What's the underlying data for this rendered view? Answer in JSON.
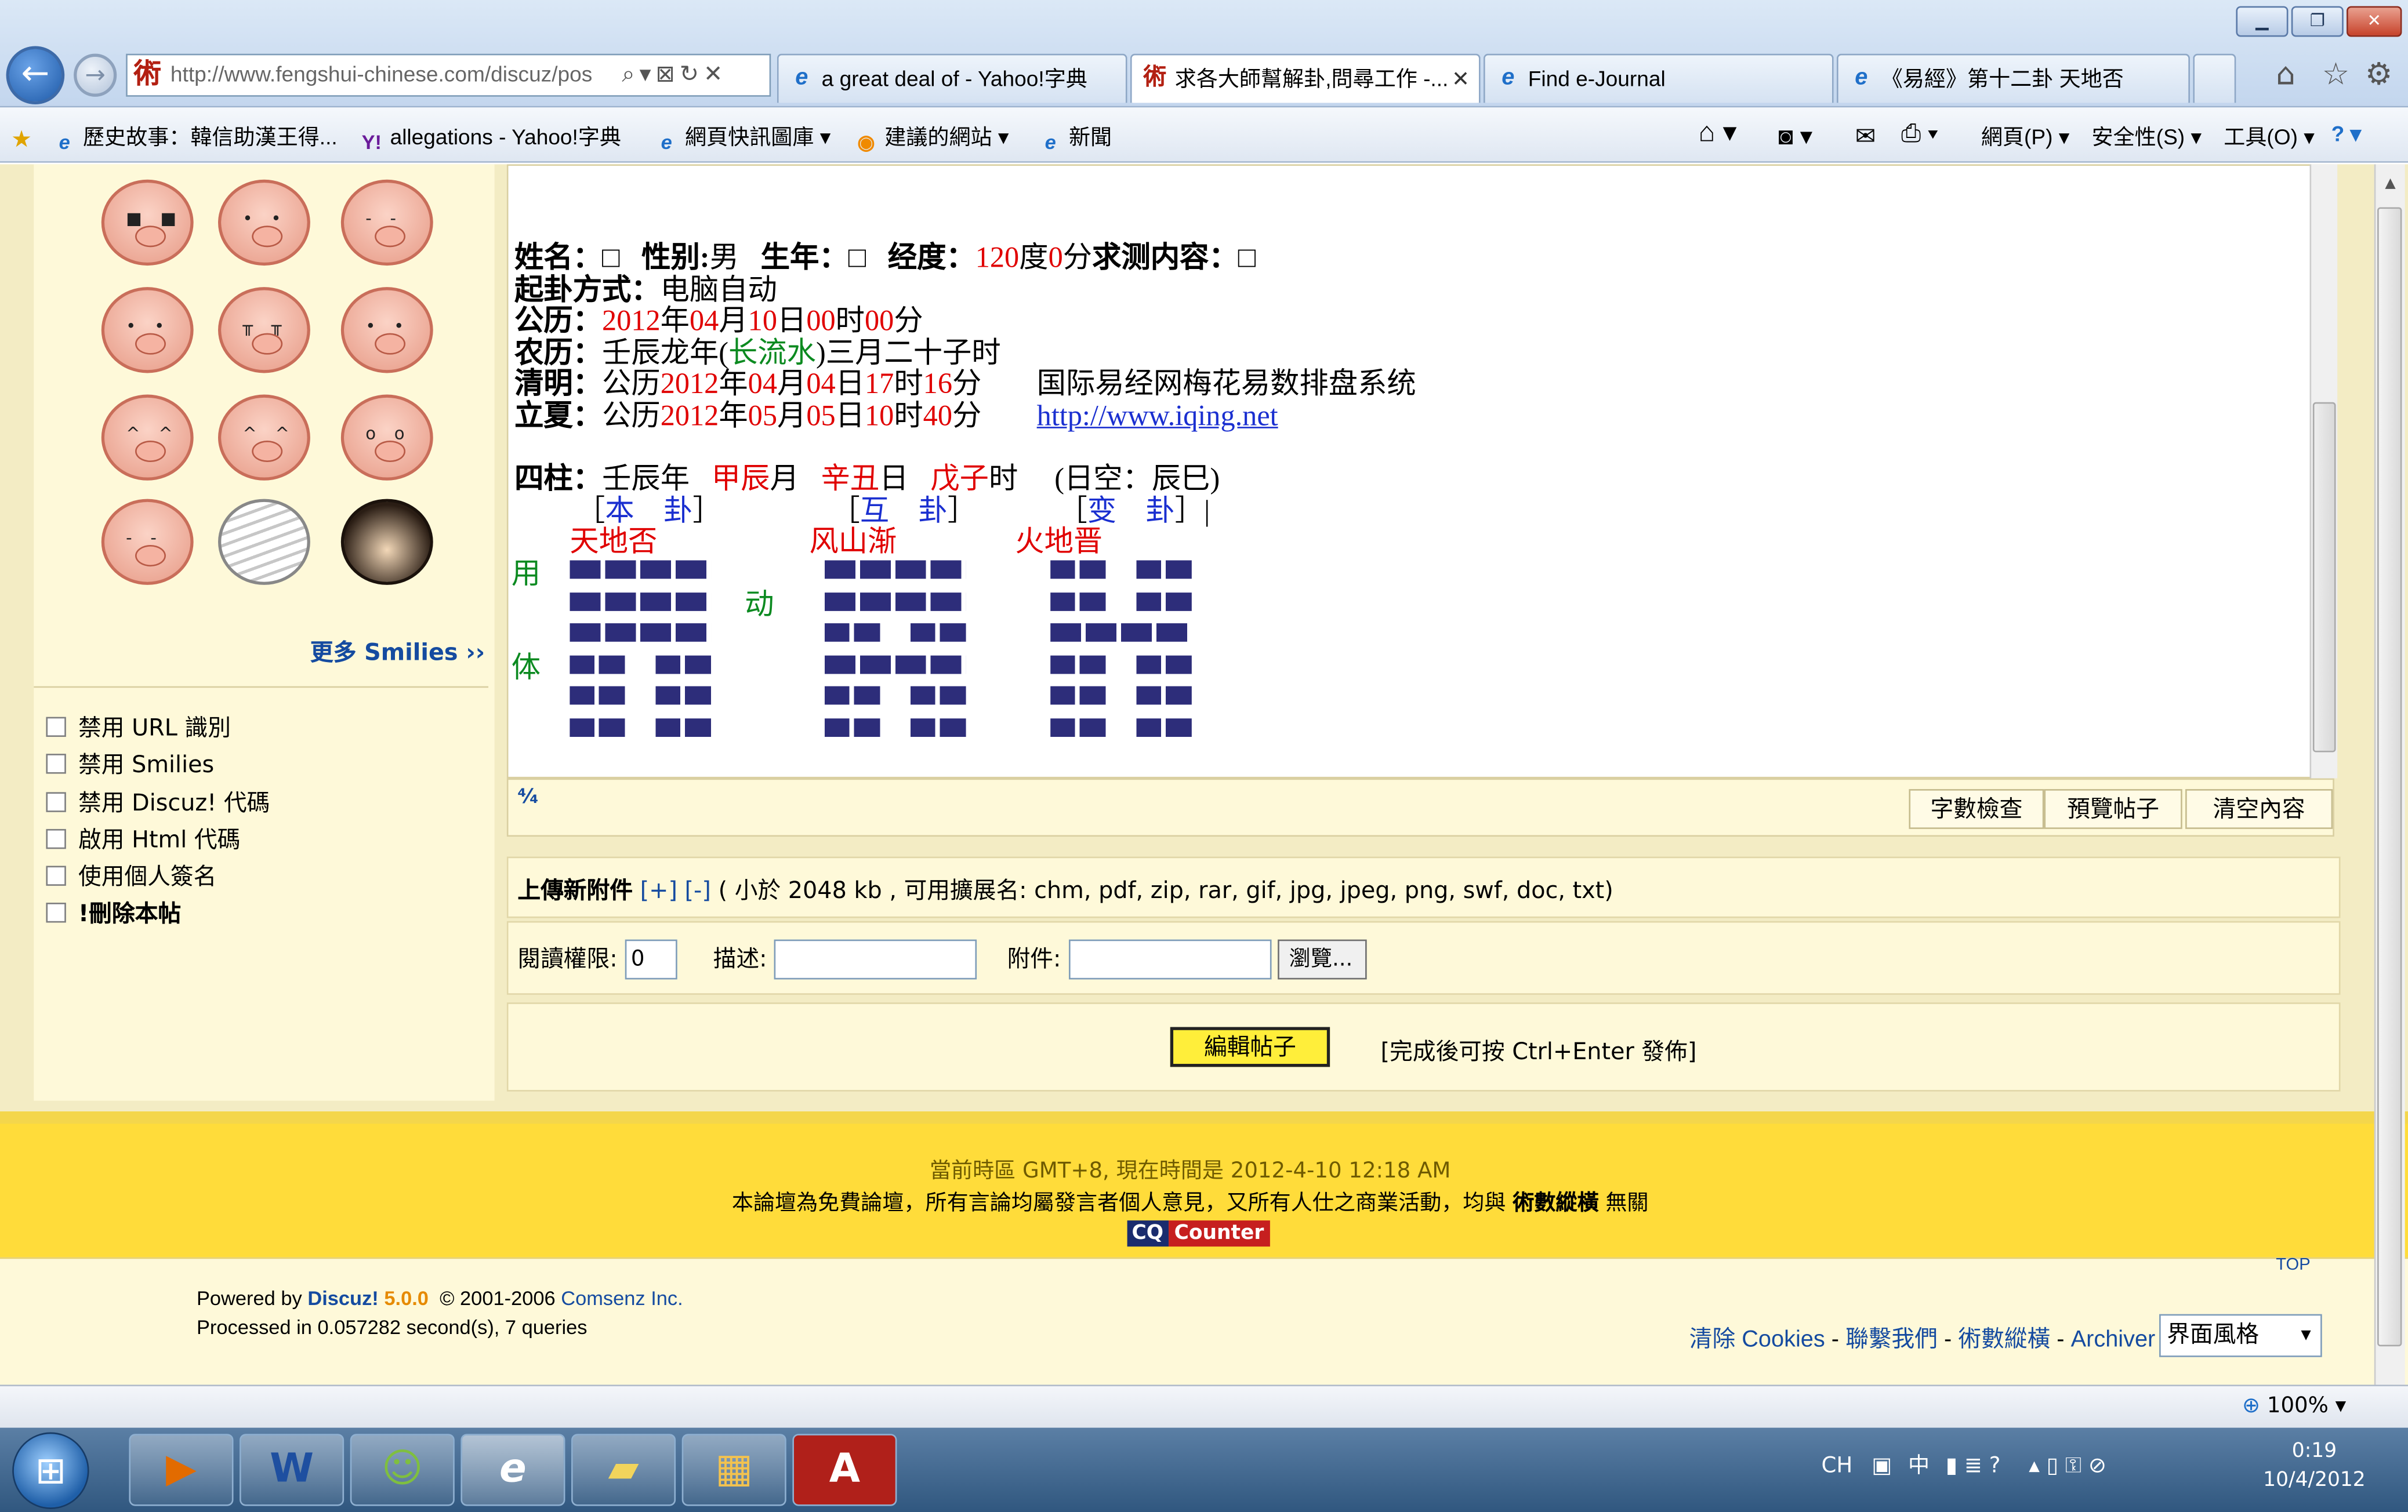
{
  "browser": {
    "address_url": "http://www.fengshui-chinese.com/discuz/pos",
    "tabs": [
      {
        "title": "a great deal of - Yahoo!字典"
      },
      {
        "title": "求各大師幫解卦,問尋工作 -..."
      },
      {
        "title": "Find e-Journal"
      },
      {
        "title": "《易經》第十二卦  天地否"
      }
    ],
    "favorites": [
      {
        "label": "歷史故事：韓信助漢王得..."
      },
      {
        "label": "allegations - Yahoo!字典"
      },
      {
        "label": "網頁快訊圖庫"
      },
      {
        "label": "建議的網站"
      },
      {
        "label": "新聞"
      }
    ],
    "menus": {
      "page": "網頁(P)",
      "safety": "安全性(S)",
      "tools": "工具(O)"
    }
  },
  "sidebar": {
    "more_smilies": "更多 Smilies ››",
    "options": [
      {
        "label": "禁用 URL 識別"
      },
      {
        "label": "禁用 Smilies"
      },
      {
        "label": "禁用 Discuz! 代碼"
      },
      {
        "label": "啟用 Html 代碼"
      },
      {
        "label": "使用個人簽名"
      },
      {
        "label": "!刪除本帖"
      }
    ]
  },
  "post": {
    "header_line": {
      "name_label": "姓名：",
      "gender_label": "性别:",
      "gender": "男",
      "birth_label": "生年：",
      "longitude_label": "经度：",
      "longitude_value": "120",
      "deg_unit": "度",
      "min_value": "0",
      "min_unit": "分",
      "query_label": "求测内容："
    },
    "method_label": "起卦方式：",
    "method": "电脑自动",
    "solar_label": "公历：",
    "solar": {
      "y": "2012",
      "m": "04",
      "d": "10",
      "h": "00",
      "mi": "00"
    },
    "units": {
      "y": "年",
      "m": "月",
      "d": "日",
      "h": "时",
      "mi": "分"
    },
    "lunar_label": "农历：",
    "lunar_a": "壬辰龙年(",
    "lunar_b": "长流水",
    "lunar_c": ")三月二十子时",
    "qingming_label": "清明：",
    "qingming_prefix": "公历",
    "qingming": {
      "y": "2012",
      "m": "04",
      "d": "04",
      "h": "17",
      "mi": "16"
    },
    "lixia_label": "立夏：",
    "lixia_prefix": "公历",
    "lixia": {
      "y": "2012",
      "m": "05",
      "d": "05",
      "h": "10",
      "mi": "40"
    },
    "system_name": "国际易经网梅花易数排盘系统",
    "system_url": "http://www.iqing.net",
    "pillars_label": "四柱：",
    "pillar_year": "壬辰",
    "pillar_year_u": "年",
    "pillar_month": "甲辰",
    "pillar_month_u": "月",
    "pillar_day": "辛丑",
    "pillar_day_u": "日",
    "pillar_hour": "戊子",
    "pillar_hour_u": "时",
    "void": "(日空：辰巳)",
    "gua_titles": [
      "本　卦",
      "互　卦",
      "变　卦"
    ],
    "gua_names": [
      "天地否",
      "风山渐",
      "火地晋"
    ],
    "yong": "用",
    "ti": "体",
    "dong": "动",
    "hexagram_lines_top_to_bottom": [
      [
        "yang",
        "yang",
        "yang",
        "yin",
        "yin",
        "yin"
      ],
      [
        "yang",
        "yang",
        "yin",
        "yang",
        "yin",
        "yin"
      ],
      [
        "yin",
        "yin",
        "yang",
        "yin",
        "yin",
        "yin"
      ]
    ]
  },
  "editor_tools": {
    "count": "字數檢查",
    "preview": "預覽帖子",
    "clear": "清空內容"
  },
  "upload": {
    "title": "上傳新附件",
    "controls": "[+] [-]",
    "hint": "( 小於 2048 kb , 可用擴展名: chm, pdf, zip, rar, gif, jpg, jpeg, png, swf, doc, txt)",
    "perm_label": "閱讀權限:",
    "perm_value": "0",
    "desc_label": "描述:",
    "file_label": "附件:",
    "browse": "瀏覽..."
  },
  "submit": {
    "label": "編輯帖子",
    "hint": "[完成後可按 Ctrl+Enter 發佈]"
  },
  "footer": {
    "time": "當前時區 GMT+8, 現在時間是 2012-4-10 12:18 AM",
    "disclaimer_a": "本論壇為免費論壇，所有言論均屬發言者個人意見，又所有人仕之商業活動，均與",
    "disclaimer_b": "術數縱橫",
    "disclaimer_c": "無關",
    "counter_a": "CQ",
    "counter_b": "Counter",
    "top": "TOP",
    "powered_prefix": "Powered by",
    "powered_name": "Discuz!",
    "powered_version": "5.0.0",
    "copyright_prefix": "© 2001-2006",
    "copyright_company": "Comsenz Inc.",
    "processed": "Processed in 0.057282 second(s), 7 queries",
    "links": [
      "清除 Cookies",
      "聯繫我們",
      "術數縱橫",
      "Archiver"
    ],
    "style_select": "界面風格"
  },
  "status": {
    "zoom": "100%"
  },
  "taskbar": {
    "lang": "CH",
    "ime": "中",
    "time": "0:19",
    "date": "10/4/2012"
  },
  "colors": {
    "page_bg": "#f3ecc4",
    "band": "#ffdc3a",
    "red": "#e00000",
    "green": "#0b8a20",
    "blue": "#1a2fd0",
    "yao": "#2d2d7a"
  }
}
